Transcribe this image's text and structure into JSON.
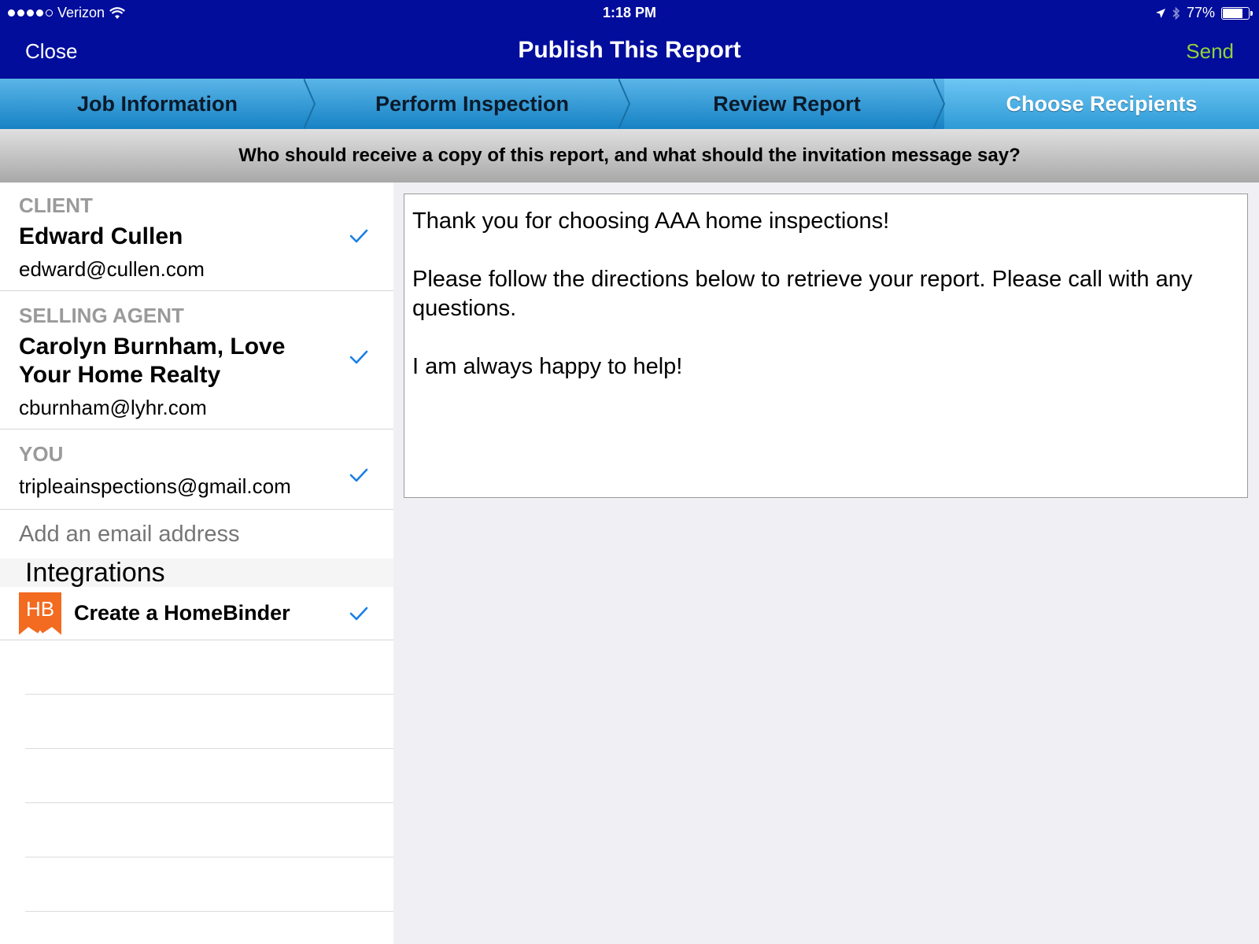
{
  "status_bar": {
    "carrier": "Verizon",
    "time": "1:18 PM",
    "battery": "77%",
    "battery_level": 0.77
  },
  "nav": {
    "close_label": "Close",
    "title": "Publish This Report",
    "send_label": "Send"
  },
  "steps": [
    {
      "label": "Job Information",
      "active": false
    },
    {
      "label": "Perform Inspection",
      "active": false
    },
    {
      "label": "Review Report",
      "active": false
    },
    {
      "label": "Choose Recipients",
      "active": true
    }
  ],
  "banner": "Who should receive a copy of this report, and what should the invitation message say?",
  "recipients": {
    "client": {
      "role": "CLIENT",
      "name": "Edward Cullen",
      "email": "edward@cullen.com",
      "checked": true
    },
    "agent": {
      "role": "SELLING AGENT",
      "name": "Carolyn Burnham, Love Your Home Realty",
      "email": "cburnham@lyhr.com",
      "checked": true
    },
    "you": {
      "role": "YOU",
      "email": "tripleainspections@gmail.com",
      "checked": true
    }
  },
  "add_email_placeholder": "Add an email address",
  "integrations": {
    "header": "Integrations",
    "items": [
      {
        "logo_text": "HB",
        "label": "Create a HomeBinder",
        "checked": true
      }
    ]
  },
  "message": "Thank you for choosing AAA home inspections!\n\nPlease follow the directions below to retrieve your report. Please call with any questions.\n\nI am always happy to help!",
  "colors": {
    "nav_bg": "#020d9c",
    "send": "#8fd23b",
    "check": "#1a7fe6",
    "homebinder": "#f26b21"
  }
}
